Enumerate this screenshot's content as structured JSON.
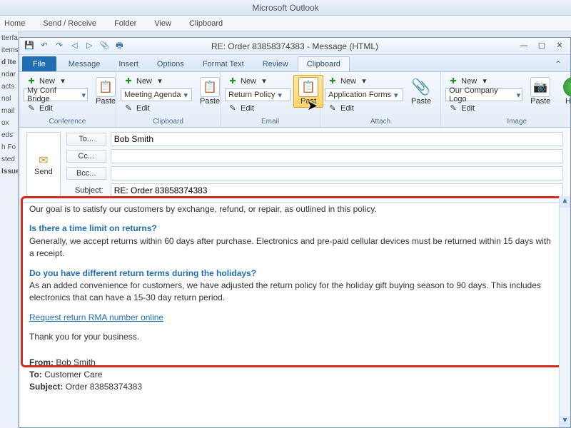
{
  "outer": {
    "title": "Microsoft Outlook",
    "menus": [
      "Home",
      "Send / Receive",
      "Folder",
      "View",
      "Clipboard"
    ]
  },
  "navpane": [
    "tterfa",
    "items",
    "d Ite",
    "ndar",
    "acts",
    "nal",
    "mail",
    "ox",
    "eds",
    "h Fo",
    "sted",
    "Issue"
  ],
  "compose": {
    "window_title": "RE: Order 83858374383 - Message (HTML)",
    "tabs": [
      "File",
      "Message",
      "Insert",
      "Options",
      "Format Text",
      "Review",
      "Clipboard"
    ],
    "active_tab": "Clipboard"
  },
  "ribbon": {
    "shared": {
      "new": "New",
      "edit": "Edit",
      "paste": "Paste",
      "help": "Help"
    },
    "groups": [
      {
        "label": "Conference",
        "combo": "My Conf Bridge"
      },
      {
        "label": "Clipboard",
        "combo": "Meeting Agenda"
      },
      {
        "label": "Email",
        "combo": "Return Policy",
        "paste_label": "Past"
      },
      {
        "label": "Attach",
        "combo": "Application Forms"
      },
      {
        "label": "Image",
        "combo": "Our Company Logo"
      }
    ]
  },
  "header": {
    "send": "Send",
    "to_label": "To...",
    "to_value": "Bob Smith",
    "cc_label": "Cc...",
    "cc_value": "",
    "bcc_label": "Bcc...",
    "bcc_value": "",
    "subject_label": "Subject:",
    "subject_value": "RE: Order 83858374383"
  },
  "body": {
    "p1": "Our goal is to satisfy our customers by exchange, refund, or repair, as outlined in this policy.",
    "q1": "Is there a time limit on returns?",
    "a1": "Generally, we accept returns within 60 days after purchase. Electronics and pre-paid cellular devices must be returned within 15 days with a receipt.",
    "q2": "Do you have different return terms during the holidays?",
    "a2": "As an added convenience for customers, we have adjusted the return policy for the holiday gift buying season to 90 days. This includes electronics that can have a 15-30 day return period.",
    "link": "Request return RMA number online",
    "p2": "Thank you for your business.",
    "from_label": "From:",
    "from_value": "Bob Smith",
    "to2_label": "To:",
    "to2_value": "Customer Care",
    "subj2_label": "Subject:",
    "subj2_value": "Order 83858374383"
  },
  "icons": {
    "plus": "✚",
    "pencil": "✎",
    "clipboard": "📋",
    "attach": "📎",
    "camera": "📷",
    "help": "?",
    "env": "✉",
    "save": "💾",
    "undo": "↶",
    "redo": "↷",
    "prev": "◁",
    "next": "▷",
    "print": "🖶"
  }
}
